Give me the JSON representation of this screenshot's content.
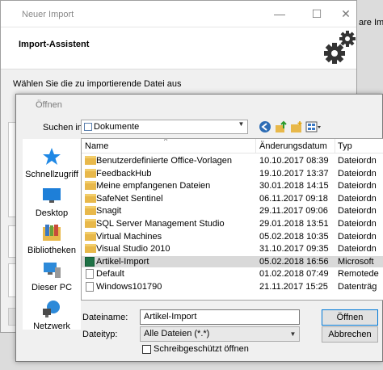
{
  "background": {
    "right_text": "are Im"
  },
  "wizard": {
    "title": "Neuer Import",
    "header_title": "Import-Assistent",
    "prompt": "Wählen Sie die zu importierende Datei aus",
    "controls": {
      "minimize": "—",
      "maximize": "☐",
      "close": "✕"
    }
  },
  "dialog": {
    "title": "Öffnen",
    "look_in_label": "Suchen in:",
    "look_in_value": "Dokumente",
    "places": [
      {
        "label": "Schnellzugriff",
        "icon": "star-icon"
      },
      {
        "label": "Desktop",
        "icon": "desktop-icon"
      },
      {
        "label": "Bibliotheken",
        "icon": "libraries-icon"
      },
      {
        "label": "Dieser PC",
        "icon": "computer-icon"
      },
      {
        "label": "Netzwerk",
        "icon": "network-icon"
      }
    ],
    "columns": {
      "name": "Name",
      "date": "Änderungsdatum",
      "type": "Typ"
    },
    "files": [
      {
        "name": "Benutzerdefinierte Office-Vorlagen",
        "date": "10.10.2017 08:39",
        "type": "Dateiordn",
        "kind": "folder"
      },
      {
        "name": "FeedbackHub",
        "date": "19.10.2017 13:37",
        "type": "Dateiordn",
        "kind": "folder"
      },
      {
        "name": "Meine empfangenen Dateien",
        "date": "30.01.2018 14:15",
        "type": "Dateiordn",
        "kind": "folder"
      },
      {
        "name": "SafeNet Sentinel",
        "date": "06.11.2017 09:18",
        "type": "Dateiordn",
        "kind": "folder"
      },
      {
        "name": "Snagit",
        "date": "29.11.2017 09:06",
        "type": "Dateiordn",
        "kind": "folder"
      },
      {
        "name": "SQL Server Management Studio",
        "date": "29.01.2018 13:51",
        "type": "Dateiordn",
        "kind": "folder"
      },
      {
        "name": "Virtual Machines",
        "date": "05.02.2018 10:35",
        "type": "Dateiordn",
        "kind": "folder"
      },
      {
        "name": "Visual Studio 2010",
        "date": "31.10.2017 09:35",
        "type": "Dateiordn",
        "kind": "folder"
      },
      {
        "name": "Artikel-Import",
        "date": "05.02.2018 16:56",
        "type": "Microsoft",
        "kind": "excel",
        "selected": true
      },
      {
        "name": "Default",
        "date": "01.02.2018 07:49",
        "type": "Remotede",
        "kind": "doc"
      },
      {
        "name": "Windows101790",
        "date": "21.11.2017 15:25",
        "type": "Datenträg",
        "kind": "doc"
      }
    ],
    "filename_label": "Dateiname:",
    "filename_value": "Artikel-Import",
    "filetype_label": "Dateityp:",
    "filetype_value": "Alle Dateien (*.*)",
    "readonly_label": "Schreibgeschützt öffnen",
    "open_button": "Öffnen",
    "cancel_button": "Abbrechen"
  }
}
